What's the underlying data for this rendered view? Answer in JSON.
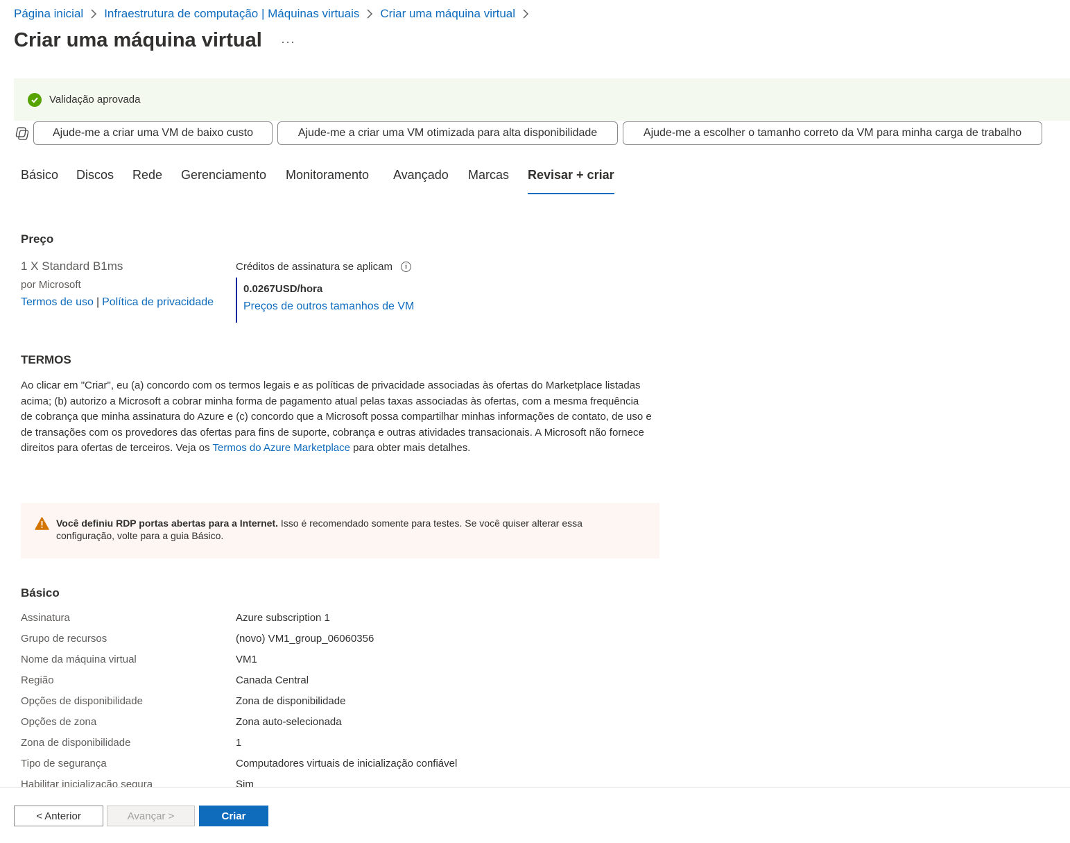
{
  "breadcrumb": [
    "Página inicial",
    "Infraestrutura de computação | Máquinas virtuais",
    "Criar uma máquina virtual"
  ],
  "page_title": "Criar uma máquina virtual",
  "more_label": "···",
  "validation": {
    "text": "Validação aprovada",
    "color": "#57a300"
  },
  "suggestions": [
    "Ajude-me a criar uma VM de baixo custo",
    "Ajude-me a criar uma VM otimizada para alta disponibilidade",
    "Ajude-me a escolher o tamanho correto da VM para minha carga de trabalho"
  ],
  "tabs": [
    "Básico",
    "Discos",
    "Rede",
    "Gerenciamento",
    "Monitoramento",
    "Avançado",
    "Marcas",
    "Revisar + criar"
  ],
  "active_tab": "Revisar + criar",
  "price": {
    "title": "Preço",
    "sku": "1 X Standard B1ms",
    "publisher": "por Microsoft",
    "terms_link": "Termos de uso",
    "separator": "|",
    "privacy_link": "Política de privacidade",
    "credits_label": "Créditos de assinatura se aplicam",
    "amount": "0.0267USD/hora",
    "other_sizes_link": "Preços de outros tamanhos de VM"
  },
  "terms": {
    "title": "TERMOS",
    "text_before": "Ao clicar em \"Criar\", eu (a) concordo com os termos legais e as políticas de privacidade associadas às ofertas do Marketplace listadas acima; (b) autorizo a Microsoft a cobrar minha forma de pagamento atual pelas taxas associadas às ofertas, com a mesma frequência de cobrança que minha assinatura do Azure e (c) concordo que a Microsoft possa compartilhar minhas informações de contato, de uso e de transações com os provedores das ofertas para fins de suporte, cobrança e outras atividades transacionais. A Microsoft não fornece direitos para ofertas de terceiros. Veja os ",
    "link": "Termos do Azure Marketplace",
    "text_after": " para obter mais detalhes."
  },
  "warning": {
    "bold": "Você definiu RDP portas abertas para a Internet.",
    "text": "  Isso é recomendado somente para testes.  Se você quiser alterar essa configuração, volte para a guia Básico.",
    "color": "#d47500"
  },
  "basic": {
    "title": "Básico",
    "rows": [
      {
        "k": "Assinatura",
        "v": "Azure subscription 1"
      },
      {
        "k": "Grupo de recursos",
        "v": "(novo) VM1_group_06060356"
      },
      {
        "k": "Nome da máquina virtual",
        "v": "VM1"
      },
      {
        "k": "Região",
        "v": "Canada Central"
      },
      {
        "k": "Opções de disponibilidade",
        "v": "Zona de disponibilidade"
      },
      {
        "k": "Opções de zona",
        "v": "Zona auto-selecionada"
      },
      {
        "k": "Zona de disponibilidade",
        "v": "1"
      },
      {
        "k": "Tipo de segurança",
        "v": "Computadores virtuais de inicialização confiável"
      },
      {
        "k": "Habilitar inicialização segura",
        "v": "Sim"
      }
    ]
  },
  "footer": {
    "prev_label": "< Anterior",
    "next_label": "Avançar >",
    "create_label": "Criar"
  },
  "colors": {
    "accent": "#0f6cbd",
    "success_bg": "#f3f9ee",
    "warning_bg": "#fdf6f3"
  }
}
